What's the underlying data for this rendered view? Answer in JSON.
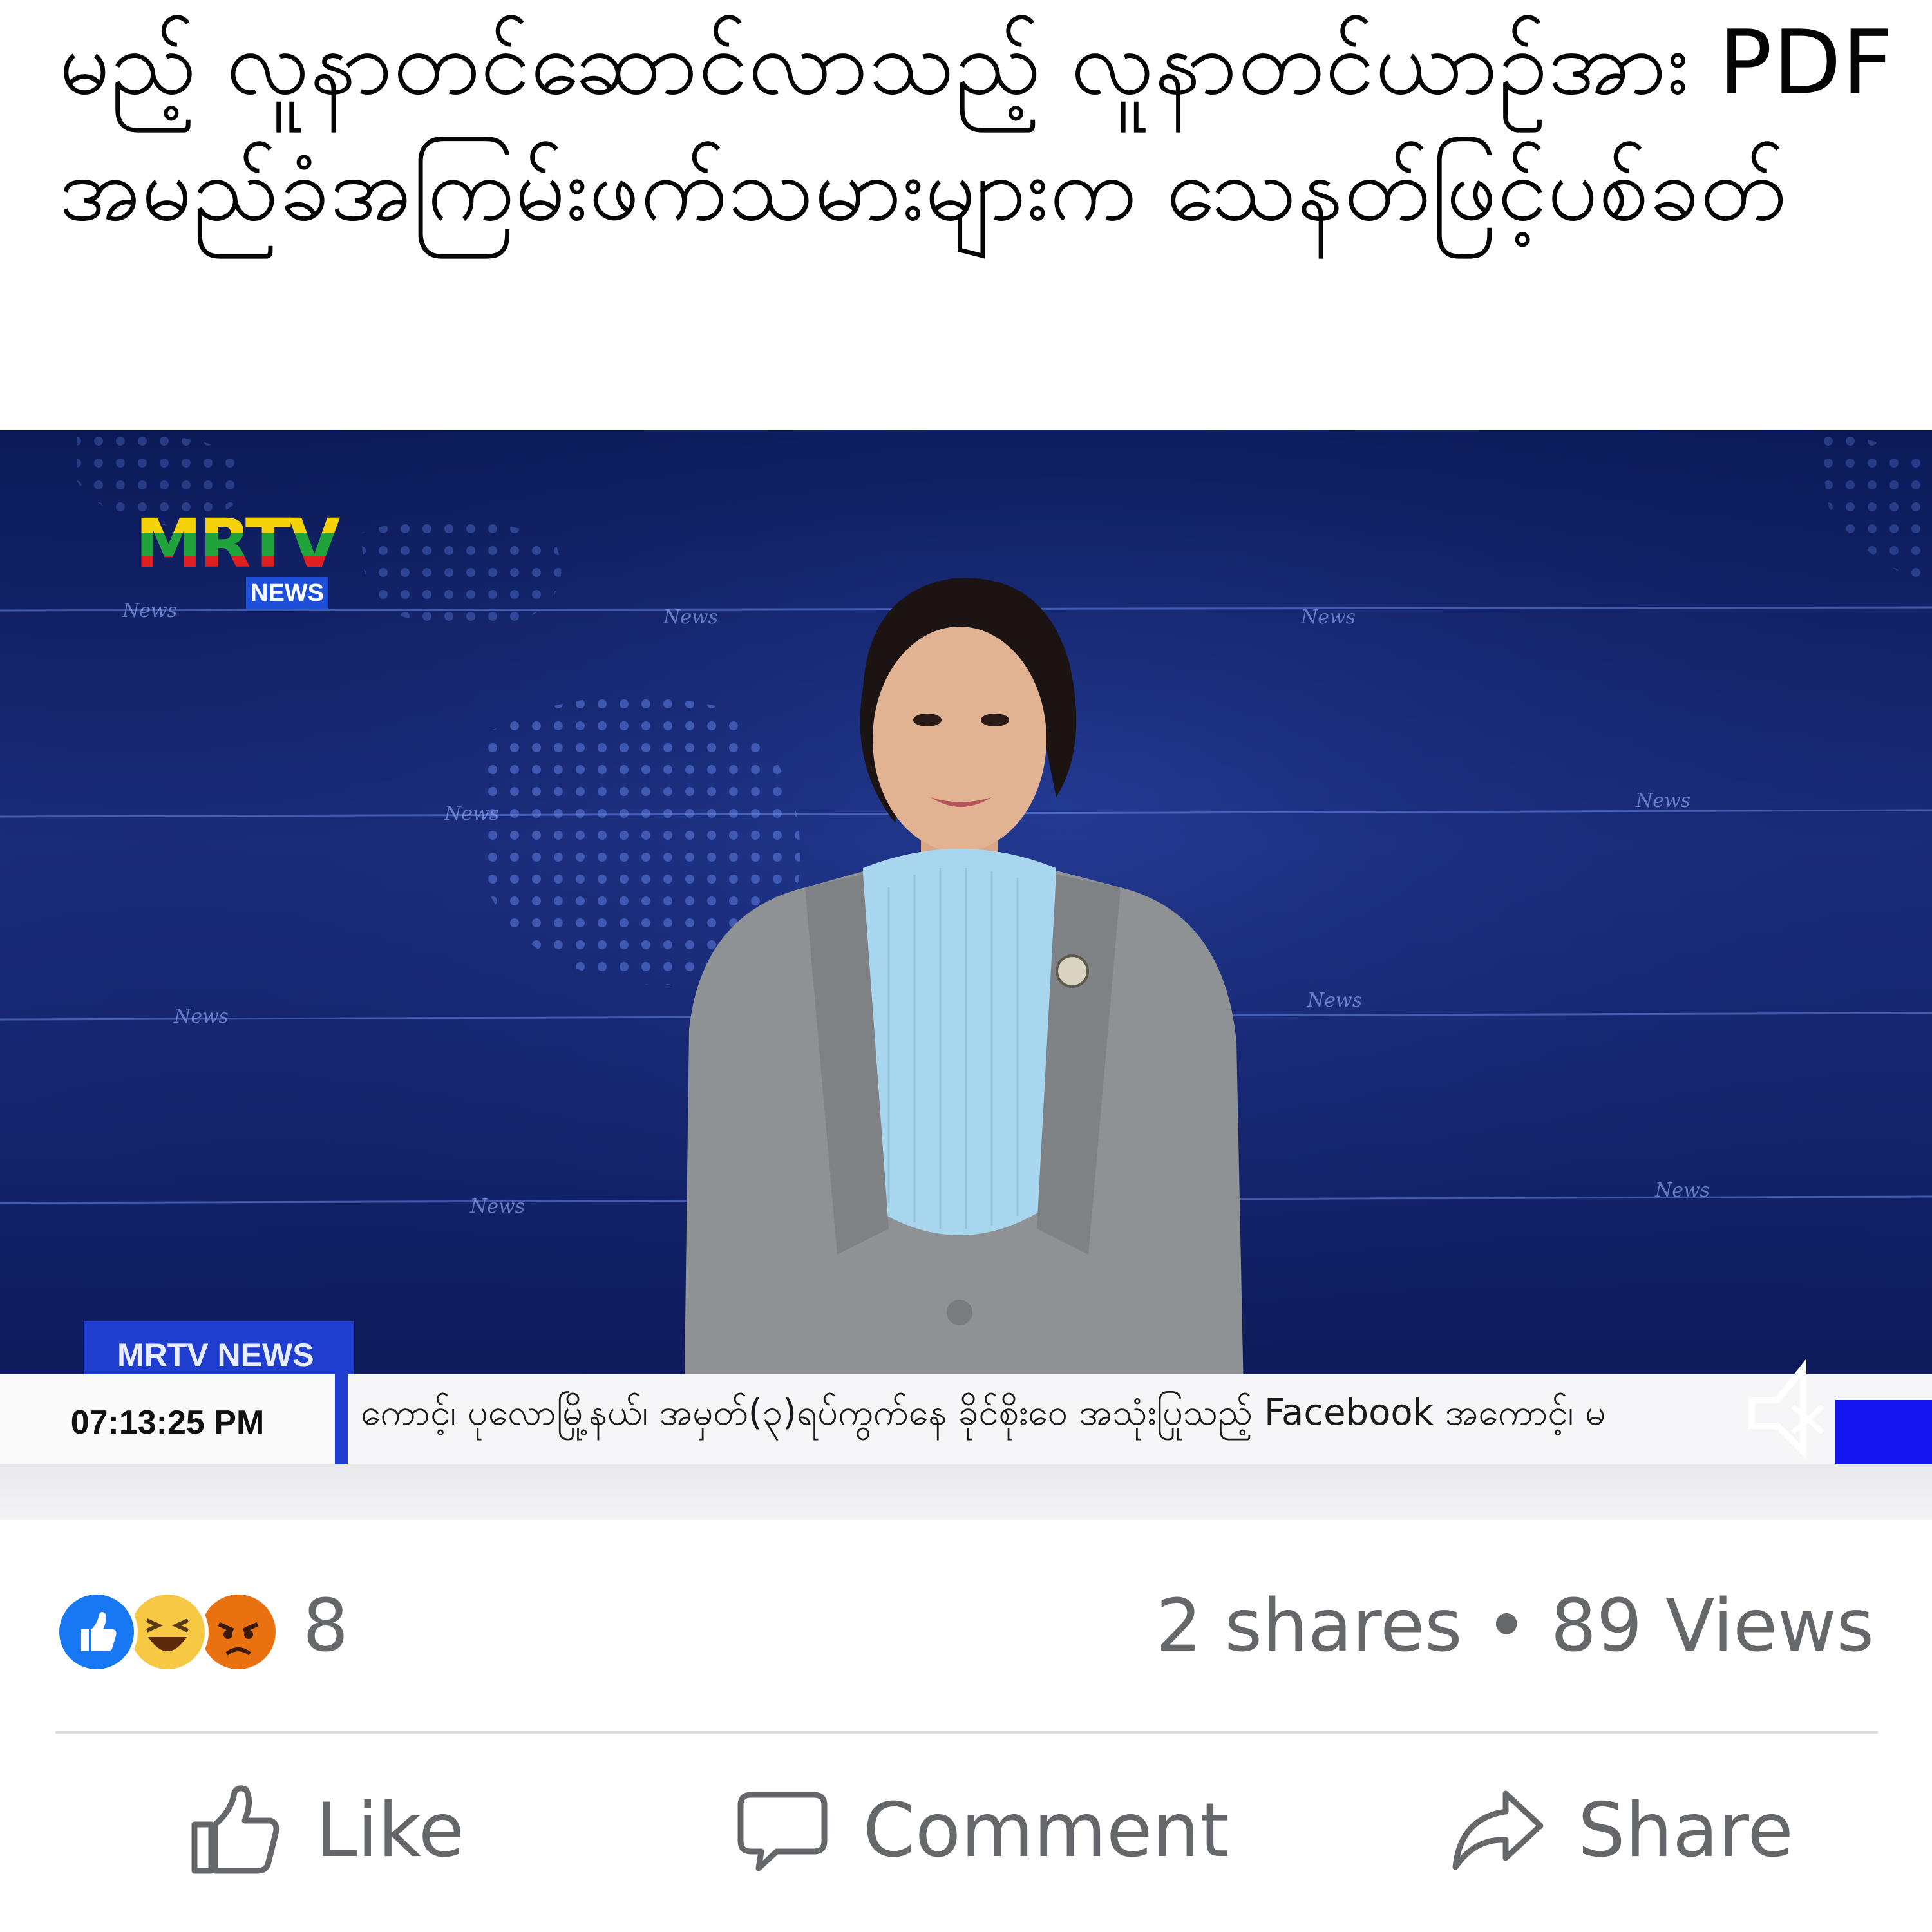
{
  "post": {
    "text": "မည့် လူနာတင်ဆောင်လာသည့် လူနာတင်ယာဉ်အား PDF အမည်ခံအကြမ်းဖက်သမားများက သေနတ်ဖြင့်ပစ်ခတ်"
  },
  "video": {
    "logo_text": "MRTV",
    "logo_badge": "NEWS",
    "lower_third_tab": "MRTV NEWS",
    "clock": "07:13:25  PM",
    "ticker": "ကောင့်၊ ပုလောမြို့နယ်၊ အမှတ်(၃)ရပ်ကွက်နေ ခိုင်စိုးဝေ အသုံးပြုသည့် Facebook အကောင့်၊ မ",
    "background_word": "News",
    "colors": {
      "logo_top": "#f5d20a",
      "logo_mid": "#1fa33a",
      "logo_bottom": "#e02020",
      "accent": "#1f3ecf"
    }
  },
  "stats": {
    "reaction_icons": [
      "like-reaction-icon",
      "haha-reaction-icon",
      "angry-reaction-icon"
    ],
    "reaction_count": "8",
    "shares_views": "2 shares • 89 Views"
  },
  "actions": {
    "like": "Like",
    "comment": "Comment",
    "share": "Share"
  },
  "colors": {
    "fb_blue": "#1877f2",
    "haha_yellow": "#f7c843",
    "angry_orange": "#e9710f",
    "muted_text": "#65676b"
  }
}
